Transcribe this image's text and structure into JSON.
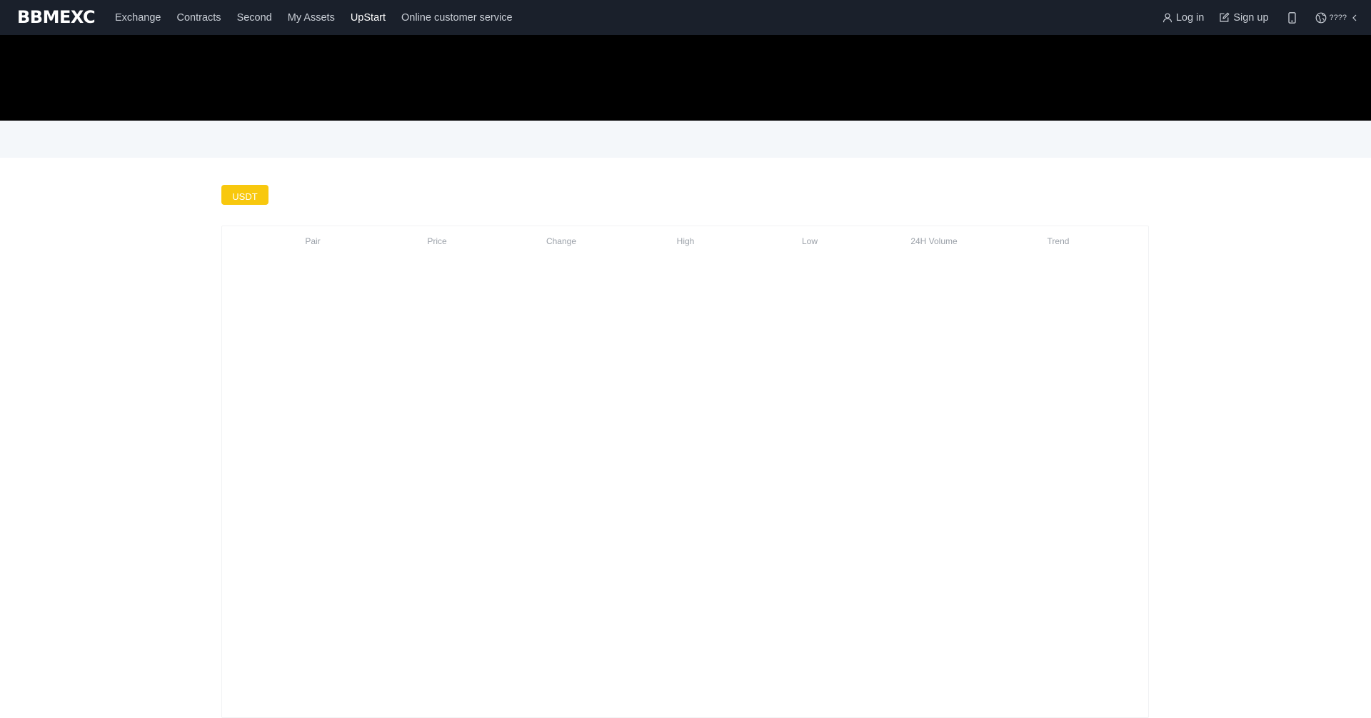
{
  "header": {
    "logo": "BBMEXC",
    "nav": [
      "Exchange",
      "Contracts",
      "Second",
      "My Assets",
      "UpStart",
      "Online customer service"
    ],
    "active_nav": "UpStart",
    "login_label": "Log in",
    "signup_label": "Sign up",
    "language_label": "????"
  },
  "market": {
    "tabs": [
      {
        "label": "USDT",
        "selected": true
      }
    ],
    "columns": [
      "Pair",
      "Price",
      "Change",
      "High",
      "Low",
      "24H Volume",
      "Trend"
    ],
    "rows": []
  },
  "colors": {
    "topbar": "#1a202b",
    "banner": "#000000",
    "strip": "#f4f7fa",
    "accent": "#f8c80e",
    "header_text": "#9aa0a8"
  },
  "icons": {
    "login": "user-icon",
    "signup": "edit-icon",
    "mobile": "mobile-phone-icon",
    "language": "globe-icon",
    "language_arrow": "chevron-left-icon"
  }
}
